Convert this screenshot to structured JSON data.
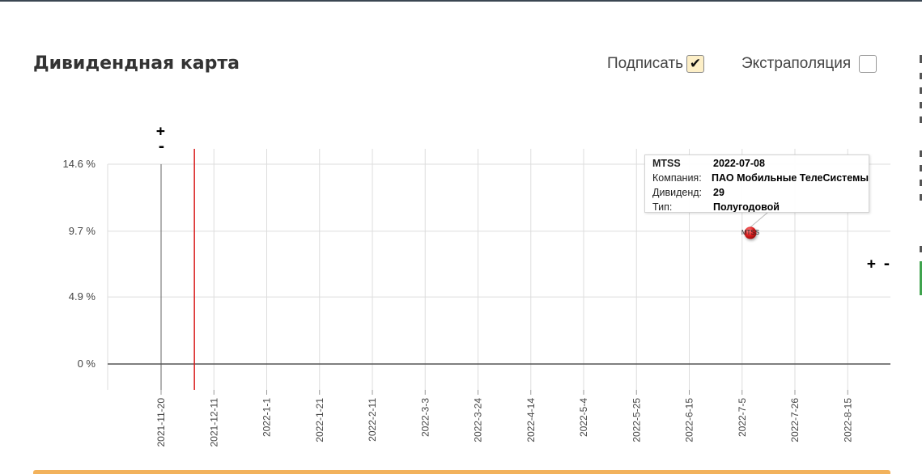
{
  "header": {
    "title": "Дивидендная карта"
  },
  "options": {
    "label_toggle": "Подписать",
    "label_checked": true,
    "extrapolation": "Экстраполяция",
    "extrapolation_checked": false
  },
  "zoom": {
    "plus": "+",
    "minus": "-"
  },
  "colors": {
    "marker": "#e02020",
    "today_line": "#d81b1b",
    "grid": "#dddddd",
    "axis": "#555555"
  },
  "chart_data": {
    "type": "scatter",
    "title": "",
    "ylabel": "",
    "xlabel": "",
    "y_ticks": [
      "0 %",
      "4.9 %",
      "9.7 %",
      "14.6 %"
    ],
    "y_values": [
      0,
      4.9,
      9.7,
      14.6
    ],
    "x_ticks": [
      "2021-11-20",
      "2021-12-11",
      "2022-1-1",
      "2022-1-21",
      "2022-2-11",
      "2022-3-3",
      "2022-3-24",
      "2022-4-14",
      "2022-5-4",
      "2022-5-25",
      "2022-6-15",
      "2022-7-5",
      "2022-7-26",
      "2022-8-15"
    ],
    "ylim": [
      0,
      14.6
    ],
    "today": "2021-12-03",
    "points": [
      {
        "label": "MTSS",
        "x": "2022-07-08",
        "y": 9.7
      }
    ],
    "tooltip": {
      "ticker": "MTSS",
      "date": "2022-07-08",
      "rows": [
        {
          "key": "Компания:",
          "value": "ПАО Мобильные ТелеСистемы"
        },
        {
          "key": "Дивиденд:",
          "value": "29"
        },
        {
          "key": "Тип:",
          "value": "Полугодовой"
        }
      ]
    }
  }
}
